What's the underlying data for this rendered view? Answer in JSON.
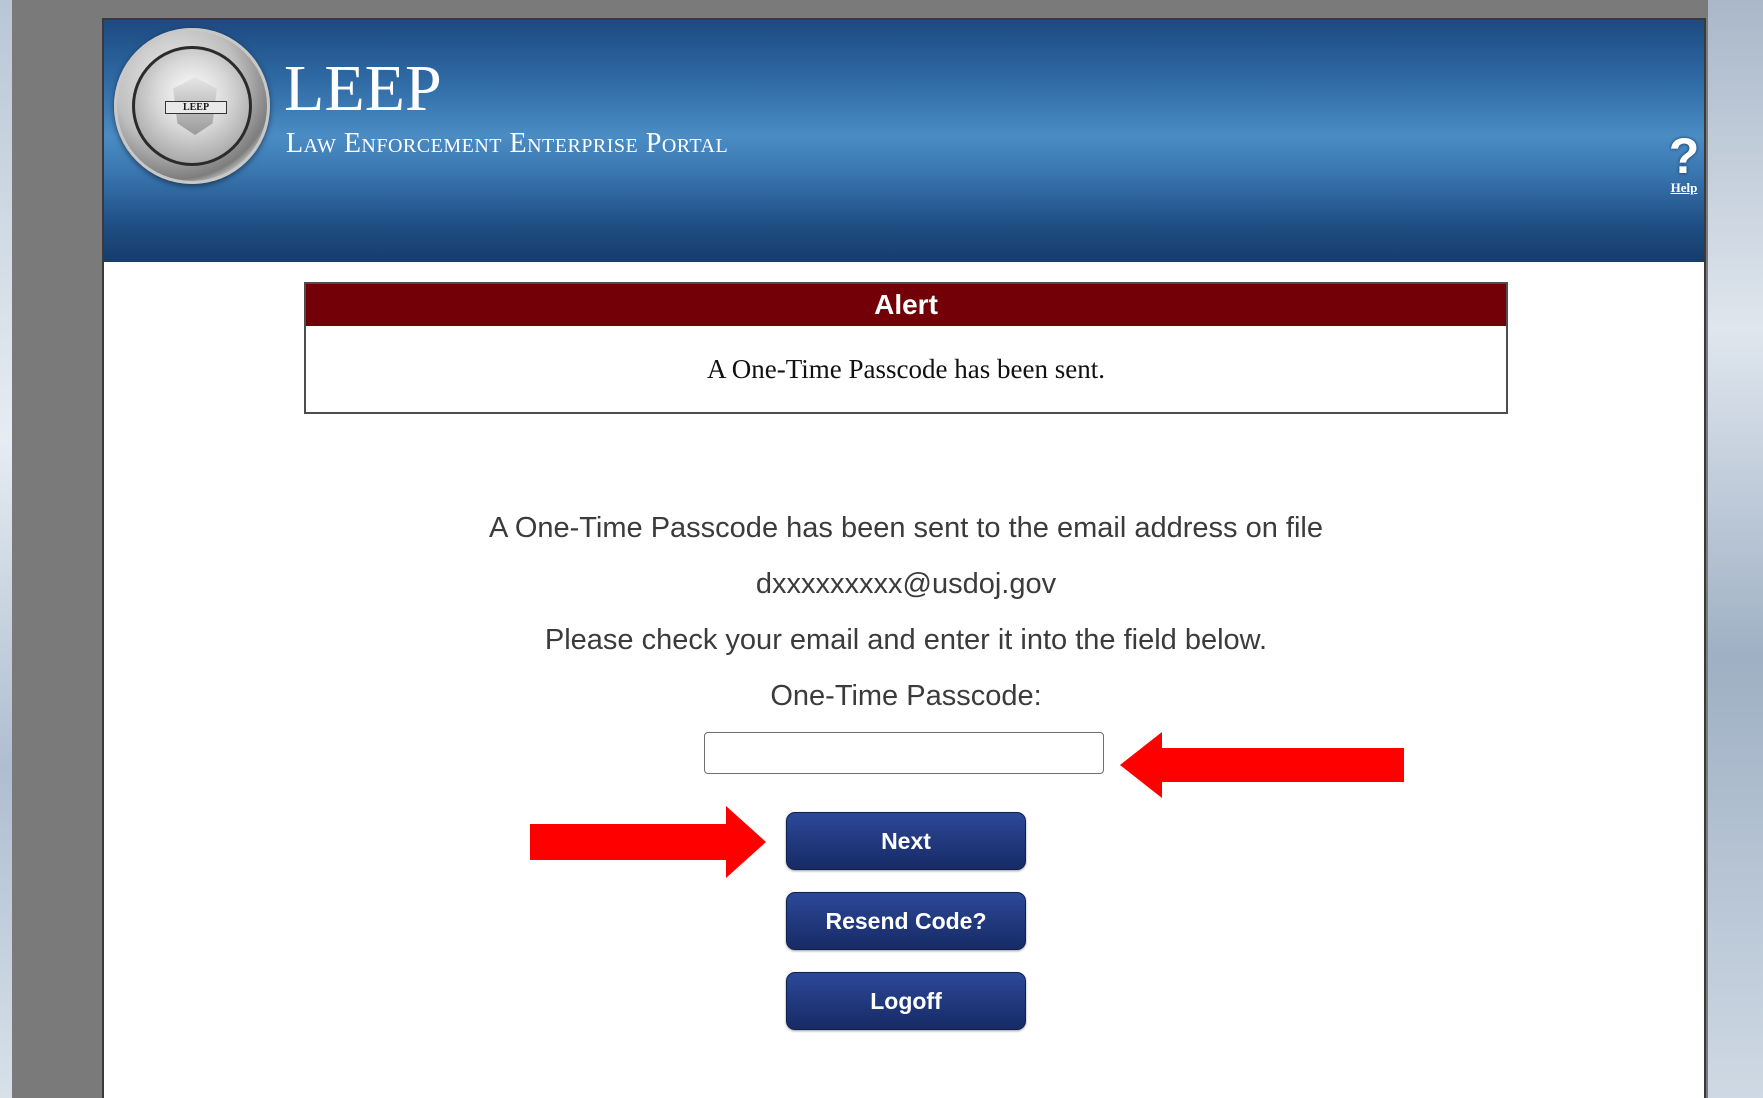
{
  "header": {
    "logo_label": "LEEP",
    "title": "LEEP",
    "subtitle": "Law Enforcement Enterprise Portal",
    "help_label": "Help",
    "help_symbol": "?"
  },
  "alert": {
    "heading": "Alert",
    "message": "A One-Time Passcode has been sent."
  },
  "content": {
    "line1": "A One-Time Passcode has been sent to the email address on file",
    "email": "dxxxxxxxxx@usdoj.gov",
    "line3": "Please check your email and enter it into the field below.",
    "passcode_label": "One-Time Passcode:",
    "passcode_value": ""
  },
  "buttons": {
    "next": "Next",
    "resend": "Resend Code?",
    "logoff": "Logoff"
  },
  "colors": {
    "banner": "#2f6aa5",
    "alert_header": "#720006",
    "button": "#223a80",
    "annotation_arrow": "#ff0000"
  },
  "icons": {
    "seal": "leep-seal-icon",
    "help": "help-question-icon",
    "arrow_left": "red-arrow-left-icon",
    "arrow_right": "red-arrow-right-icon"
  }
}
